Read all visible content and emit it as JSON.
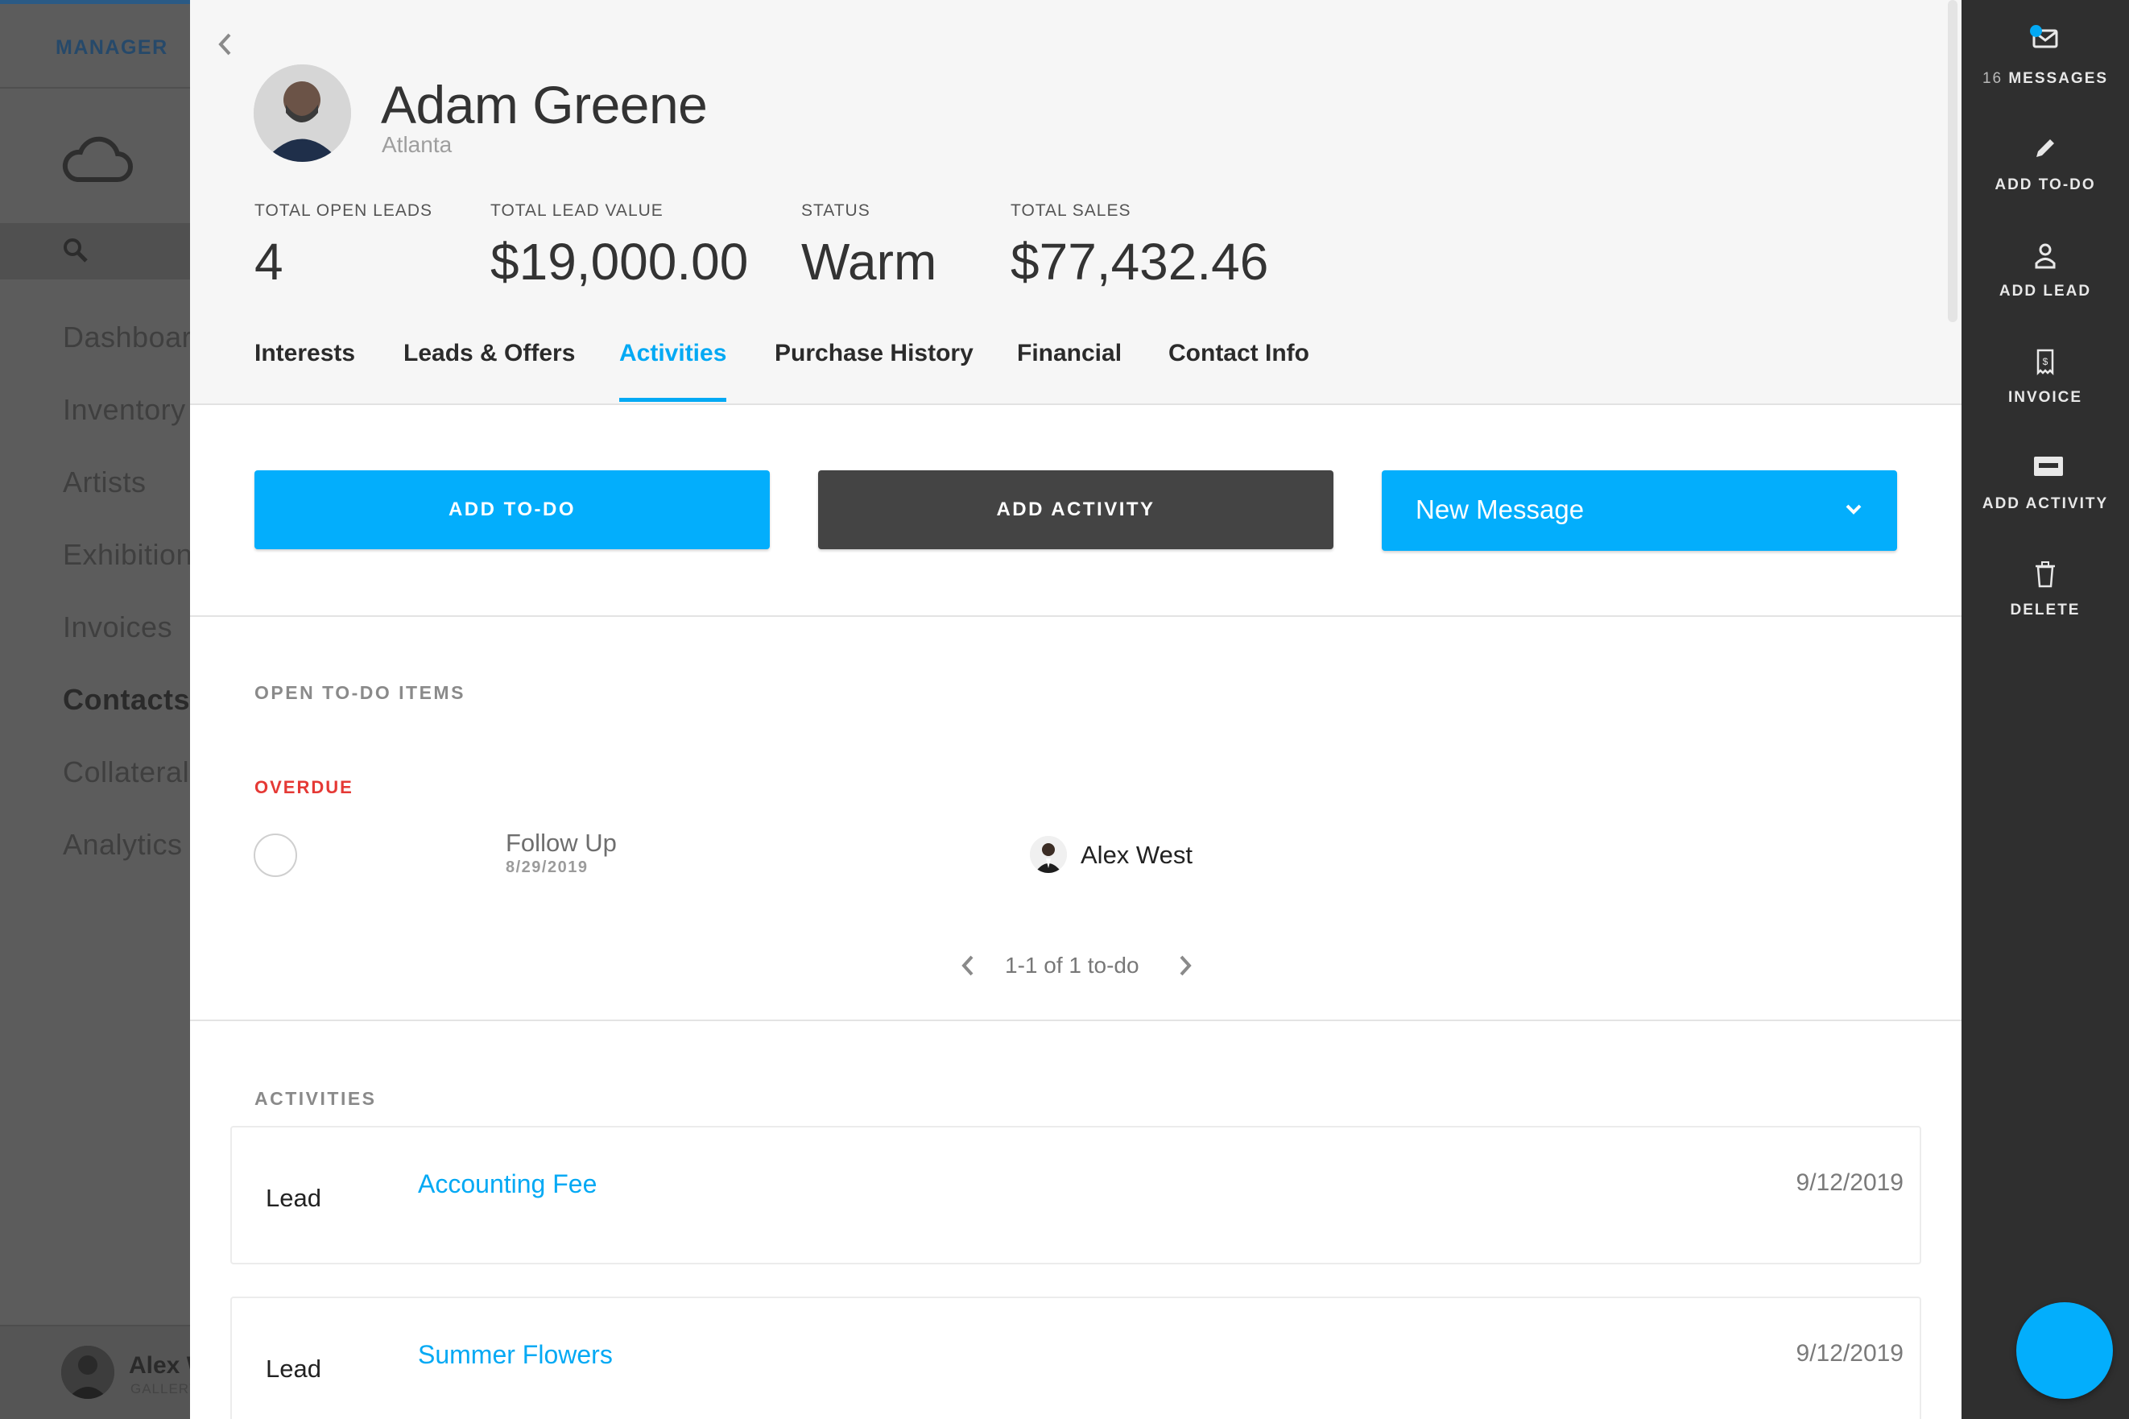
{
  "left_nav": {
    "brand": "MANAGER",
    "items": [
      {
        "label": "Dashboard"
      },
      {
        "label": "Inventory"
      },
      {
        "label": "Artists"
      },
      {
        "label": "Exhibitions"
      },
      {
        "label": "Invoices"
      },
      {
        "label": "Contacts"
      },
      {
        "label": "Collateral"
      },
      {
        "label": "Analytics"
      }
    ],
    "user": {
      "name": "Alex West",
      "org": "GALLERY"
    }
  },
  "contact": {
    "name": "Adam Greene",
    "location": "Atlanta",
    "stats": [
      {
        "label": "TOTAL OPEN LEADS",
        "value": "4"
      },
      {
        "label": "TOTAL LEAD VALUE",
        "value": "$19,000.00"
      },
      {
        "label": "STATUS",
        "value": "Warm"
      },
      {
        "label": "TOTAL SALES",
        "value": "$77,432.46"
      }
    ]
  },
  "tabs": [
    {
      "label": "Interests"
    },
    {
      "label": "Leads & Offers"
    },
    {
      "label": "Activities",
      "active": true
    },
    {
      "label": "Purchase History"
    },
    {
      "label": "Financial"
    },
    {
      "label": "Contact Info"
    }
  ],
  "actions": {
    "add_todo": "ADD TO-DO",
    "add_activity": "ADD ACTIVITY",
    "message_select": "New Message"
  },
  "todo_section": {
    "title": "OPEN TO-DO ITEMS",
    "overdue_label": "OVERDUE",
    "items": [
      {
        "title": "Follow Up",
        "date": "8/29/2019",
        "owner": "Alex West"
      }
    ],
    "pager": "1-1 of 1 to-do"
  },
  "activities_section": {
    "title": "ACTIVITIES",
    "items": [
      {
        "type": "Lead",
        "name": "Accounting Fee",
        "date": "9/12/2019"
      },
      {
        "type": "Lead",
        "name": "Summer Flowers",
        "date": "9/12/2019"
      }
    ]
  },
  "right_rail": {
    "messages_count": "16",
    "messages_label": "MESSAGES",
    "items": [
      {
        "label": "ADD TO-DO",
        "icon": "pencil-icon"
      },
      {
        "label": "ADD LEAD",
        "icon": "person-icon"
      },
      {
        "label": "INVOICE",
        "icon": "invoice-icon"
      },
      {
        "label": "ADD ACTIVITY",
        "icon": "activity-card-icon"
      },
      {
        "label": "DELETE",
        "icon": "trash-icon"
      }
    ]
  },
  "colors": {
    "accent": "#03a9f4",
    "dark_button": "#444444",
    "overdue": "#e53935",
    "rail_bg": "#2f2f2f"
  }
}
